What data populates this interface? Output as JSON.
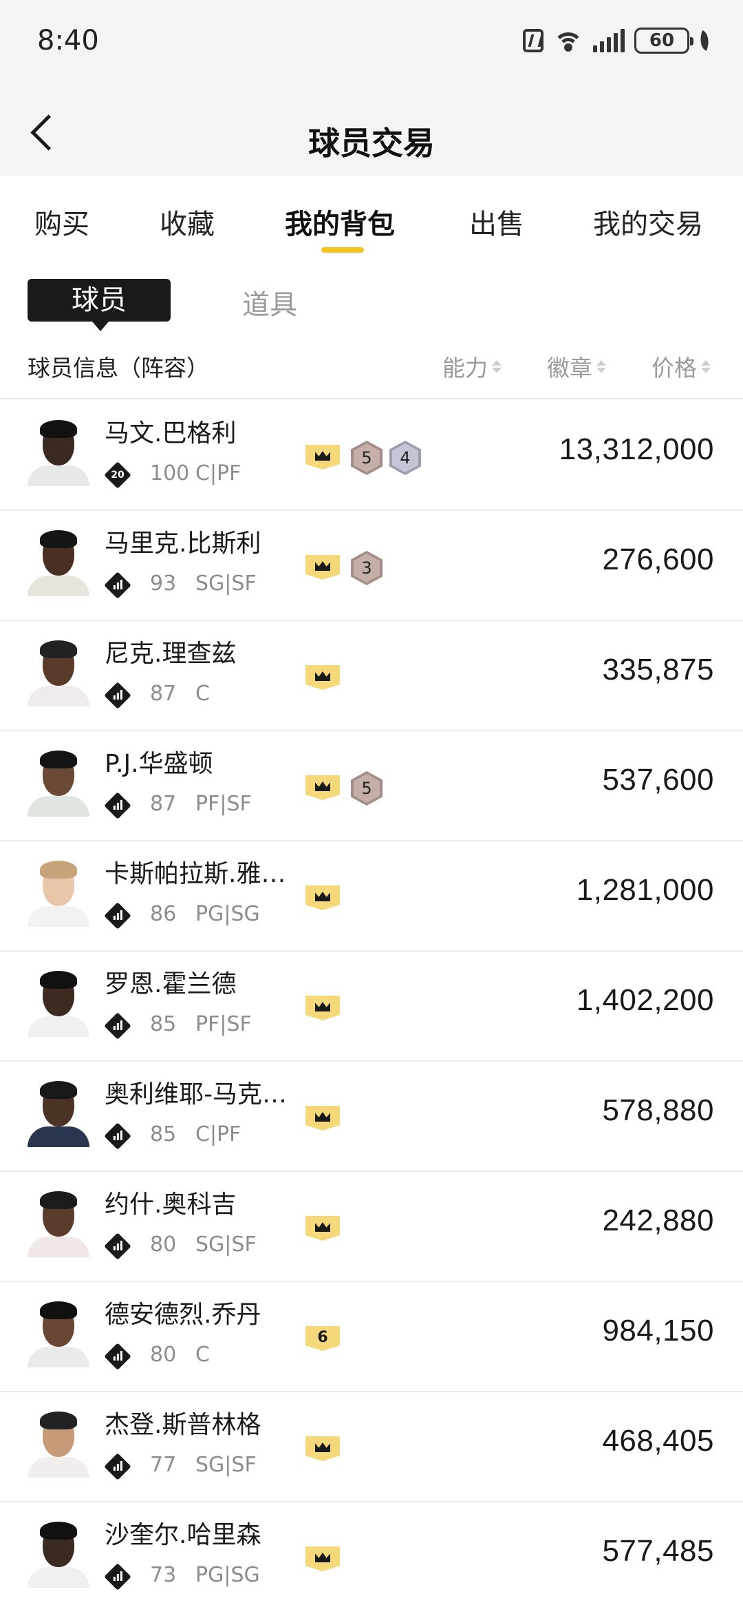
{
  "status_bar": {
    "time": "8:40",
    "battery": "60"
  },
  "header": {
    "title": "球员交易"
  },
  "tabs": [
    {
      "label": "购买",
      "active": false
    },
    {
      "label": "收藏",
      "active": false
    },
    {
      "label": "我的背包",
      "active": true
    },
    {
      "label": "出售",
      "active": false
    },
    {
      "label": "我的交易",
      "active": false
    }
  ],
  "sub_tabs": {
    "player": "球员",
    "item": "道具",
    "selected": "球员"
  },
  "list_header": {
    "info": "球员信息（阵容）",
    "ability": "能力",
    "badge": "徽章",
    "price": "价格"
  },
  "colors": {
    "accent": "#f5c41c",
    "badge_gold": "#f5d87a",
    "badge_bronze": "#c4b0a9",
    "badge_silver": "#c3c6d4"
  },
  "players": [
    {
      "name": "马文.巴格利",
      "rating_label": "20",
      "overall": "100",
      "position": "C|PF",
      "top_badge": "crown",
      "badges": [
        {
          "level": "5",
          "type": "bronze"
        },
        {
          "level": "4",
          "type": "silver"
        }
      ],
      "price": "13,312,000"
    },
    {
      "name": "马里克.比斯利",
      "rating_label": "",
      "overall": "93",
      "position": "SG|SF",
      "top_badge": "crown",
      "badges": [
        {
          "level": "3",
          "type": "bronze"
        }
      ],
      "price": "276,600"
    },
    {
      "name": "尼克.理查兹",
      "rating_label": "",
      "overall": "87",
      "position": "C",
      "top_badge": "crown",
      "badges": [],
      "price": "335,875"
    },
    {
      "name": "P.J.华盛顿",
      "rating_label": "",
      "overall": "87",
      "position": "PF|SF",
      "top_badge": "crown",
      "badges": [
        {
          "level": "5",
          "type": "bronze"
        }
      ],
      "price": "537,600"
    },
    {
      "name": "卡斯帕拉斯.雅…",
      "rating_label": "",
      "overall": "86",
      "position": "PG|SG",
      "top_badge": "crown",
      "badges": [],
      "price": "1,281,000"
    },
    {
      "name": "罗恩.霍兰德",
      "rating_label": "",
      "overall": "85",
      "position": "PF|SF",
      "top_badge": "crown",
      "badges": [],
      "price": "1,402,200"
    },
    {
      "name": "奥利维耶-马克…",
      "rating_label": "",
      "overall": "85",
      "position": "C|PF",
      "top_badge": "crown",
      "badges": [],
      "price": "578,880"
    },
    {
      "name": "约什.奥科吉",
      "rating_label": "",
      "overall": "80",
      "position": "SG|SF",
      "top_badge": "crown",
      "badges": [],
      "price": "242,880"
    },
    {
      "name": "德安德烈.乔丹",
      "rating_label": "",
      "overall": "80",
      "position": "C",
      "top_badge": "6",
      "badges": [],
      "price": "984,150"
    },
    {
      "name": "杰登.斯普林格",
      "rating_label": "",
      "overall": "77",
      "position": "SG|SF",
      "top_badge": "crown",
      "badges": [],
      "price": "468,405"
    },
    {
      "name": "沙奎尔.哈里森",
      "rating_label": "",
      "overall": "73",
      "position": "PG|SG",
      "top_badge": "crown",
      "badges": [],
      "price": "577,485"
    }
  ]
}
